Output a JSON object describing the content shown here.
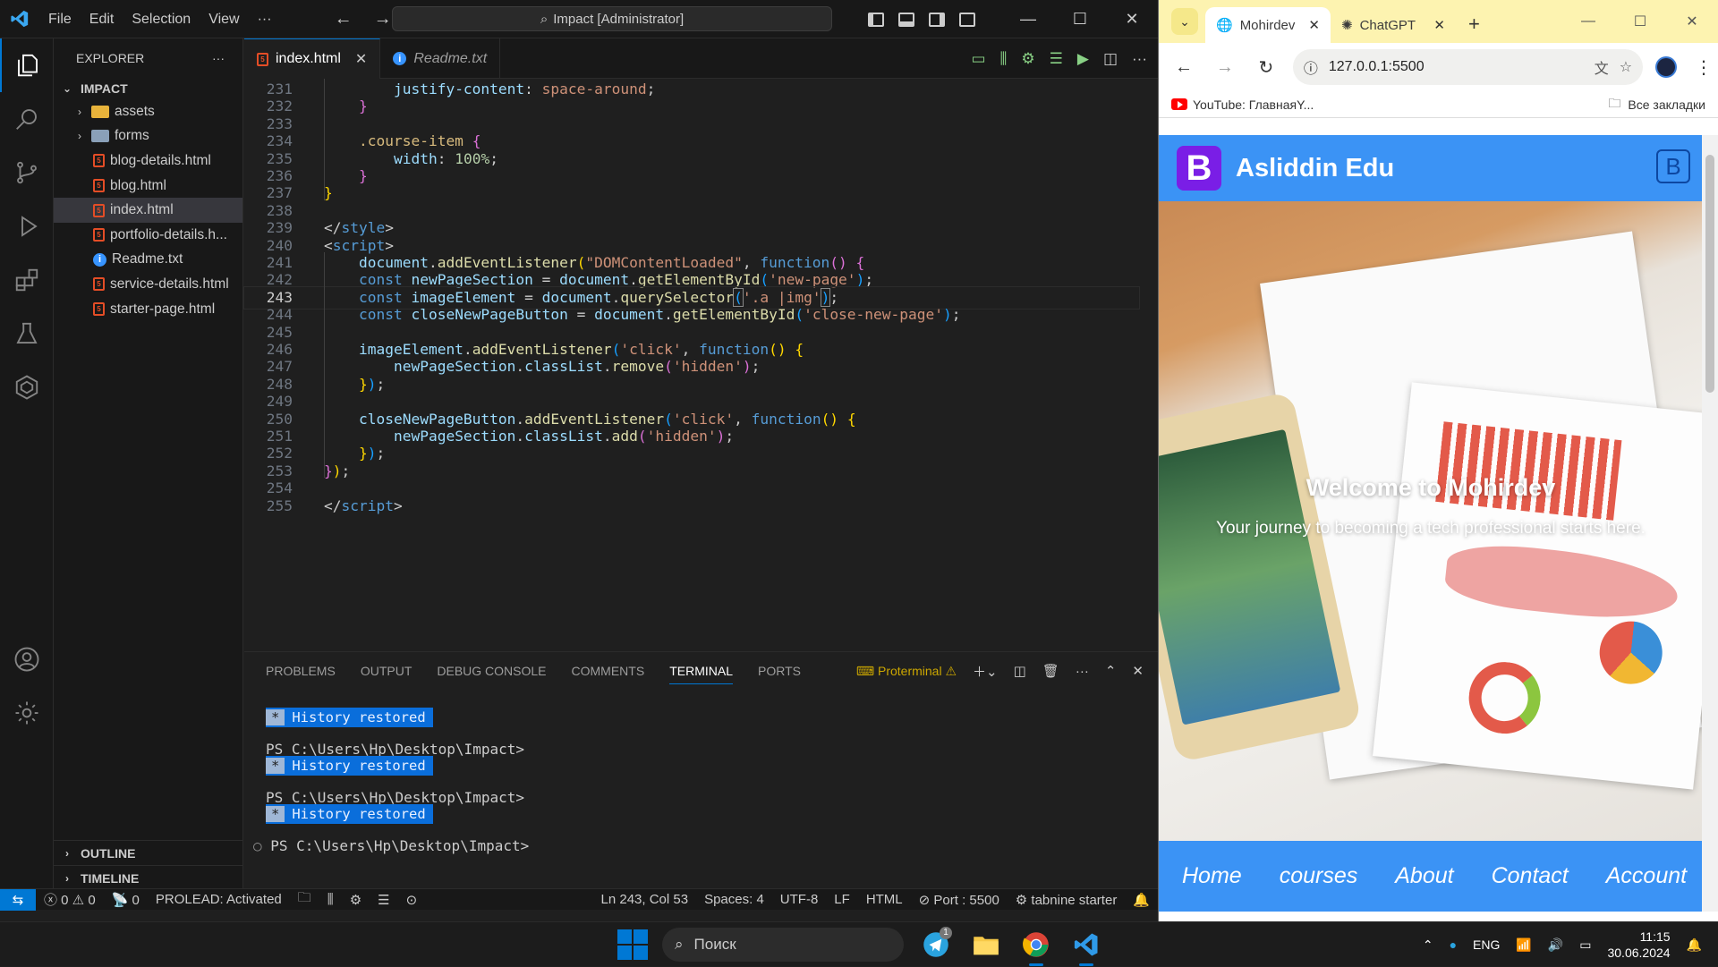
{
  "vscode": {
    "menu": [
      "File",
      "Edit",
      "Selection",
      "View",
      "···"
    ],
    "command_center": "Impact [Administrator]",
    "explorer_title": "EXPLORER",
    "project": "IMPACT",
    "tree": [
      {
        "type": "folder",
        "name": "assets",
        "color": "#e8b33b"
      },
      {
        "type": "folder",
        "name": "forms",
        "color": "#8aa0b8"
      },
      {
        "type": "html",
        "name": "blog-details.html"
      },
      {
        "type": "html",
        "name": "blog.html"
      },
      {
        "type": "html",
        "name": "index.html",
        "selected": true
      },
      {
        "type": "html",
        "name": "portfolio-details.h..."
      },
      {
        "type": "info",
        "name": "Readme.txt"
      },
      {
        "type": "html",
        "name": "service-details.html"
      },
      {
        "type": "html",
        "name": "starter-page.html"
      }
    ],
    "outline_label": "OUTLINE",
    "timeline_label": "TIMELINE",
    "tabs": [
      {
        "name": "index.html",
        "active": true
      },
      {
        "name": "Readme.txt",
        "active": false
      }
    ],
    "code_lines": [
      {
        "n": "231",
        "html": "        <span class=\"p\">justify-content</span><span class=\"pn\">: </span><span class=\"v\">space-around</span><span class=\"pn\">;</span>"
      },
      {
        "n": "232",
        "html": "    <span class=\"br2\">}</span>"
      },
      {
        "n": "233",
        "html": ""
      },
      {
        "n": "234",
        "html": "    <span class=\"cls\">.course-item</span> <span class=\"br2\">{</span>"
      },
      {
        "n": "235",
        "html": "        <span class=\"p\">width</span><span class=\"pn\">: </span><span class=\"n\">100%</span><span class=\"pn\">;</span>"
      },
      {
        "n": "236",
        "html": "    <span class=\"br2\">}</span>"
      },
      {
        "n": "237",
        "html": "<span class=\"br1\">}</span>"
      },
      {
        "n": "238",
        "html": ""
      },
      {
        "n": "239",
        "html": "<span class=\"pn\">&lt;/</span><span class=\"t\">style</span><span class=\"pn\">&gt;</span>"
      },
      {
        "n": "240",
        "html": "<span class=\"pn\">&lt;</span><span class=\"t\">script</span><span class=\"pn\">&gt;</span>"
      },
      {
        "n": "241",
        "html": "    <span class=\"id\">document</span><span class=\"pn\">.</span><span class=\"f\">addEventListener</span><span class=\"br1\">(</span><span class=\"s\">\"DOMContentLoaded\"</span><span class=\"pn\">, </span><span class=\"kw\">function</span><span class=\"br2\">()</span> <span class=\"br2\">{</span>"
      },
      {
        "n": "242",
        "html": "    <span class=\"kw\">const</span> <span class=\"id\">newPageSection</span> <span class=\"pn\">= </span><span class=\"id\">document</span><span class=\"pn\">.</span><span class=\"f\">getElementById</span><span class=\"br3\">(</span><span class=\"s\">'new-page'</span><span class=\"br3\">)</span><span class=\"pn\">;</span>"
      },
      {
        "n": "243",
        "current": true,
        "html": "    <span class=\"kw\">const</span> <span class=\"id\">imageElement</span> <span class=\"pn\">= </span><span class=\"id\">document</span><span class=\"pn\">.</span><span class=\"f\">querySelector</span><span class=\"br3\" style=\"outline:1px solid #888\">(</span><span class=\"s\">'.a |img'</span><span class=\"br3\" style=\"outline:1px solid #888\">)</span><span class=\"pn\">;</span>"
      },
      {
        "n": "244",
        "html": "    <span class=\"kw\">const</span> <span class=\"id\">closeNewPageButton</span> <span class=\"pn\">= </span><span class=\"id\">document</span><span class=\"pn\">.</span><span class=\"f\">getElementById</span><span class=\"br3\">(</span><span class=\"s\">'close-new-page'</span><span class=\"br3\">)</span><span class=\"pn\">;</span>"
      },
      {
        "n": "245",
        "html": ""
      },
      {
        "n": "246",
        "html": "    <span class=\"id\">imageElement</span><span class=\"pn\">.</span><span class=\"f\">addEventListener</span><span class=\"br3\">(</span><span class=\"s\">'click'</span><span class=\"pn\">, </span><span class=\"kw\">function</span><span class=\"br1\">()</span> <span class=\"br1\">{</span>"
      },
      {
        "n": "247",
        "html": "        <span class=\"id\">newPageSection</span><span class=\"pn\">.</span><span class=\"id\">classList</span><span class=\"pn\">.</span><span class=\"f\">remove</span><span class=\"br2\">(</span><span class=\"s\">'hidden'</span><span class=\"br2\">)</span><span class=\"pn\">;</span>"
      },
      {
        "n": "248",
        "html": "    <span class=\"br1\">}</span><span class=\"br3\">)</span><span class=\"pn\">;</span>"
      },
      {
        "n": "249",
        "html": ""
      },
      {
        "n": "250",
        "html": "    <span class=\"id\">closeNewPageButton</span><span class=\"pn\">.</span><span class=\"f\">addEventListener</span><span class=\"br3\">(</span><span class=\"s\">'click'</span><span class=\"pn\">, </span><span class=\"kw\">function</span><span class=\"br1\">()</span> <span class=\"br1\">{</span>"
      },
      {
        "n": "251",
        "html": "        <span class=\"id\">newPageSection</span><span class=\"pn\">.</span><span class=\"id\">classList</span><span class=\"pn\">.</span><span class=\"f\">add</span><span class=\"br2\">(</span><span class=\"s\">'hidden'</span><span class=\"br2\">)</span><span class=\"pn\">;</span>"
      },
      {
        "n": "252",
        "html": "    <span class=\"br1\">}</span><span class=\"br3\">)</span><span class=\"pn\">;</span>"
      },
      {
        "n": "253",
        "html": "<span class=\"br2\">}</span><span class=\"br1\">)</span><span class=\"pn\">;</span>"
      },
      {
        "n": "254",
        "html": ""
      },
      {
        "n": "255",
        "html": "<span class=\"pn\">&lt;/</span><span class=\"t\">script</span><span class=\"pn\">&gt;</span>"
      }
    ],
    "panel_tabs": [
      {
        "name": "PROBLEMS"
      },
      {
        "name": "OUTPUT"
      },
      {
        "name": "DEBUG CONSOLE"
      },
      {
        "name": "COMMENTS"
      },
      {
        "name": "TERMINAL",
        "active": true
      },
      {
        "name": "PORTS"
      }
    ],
    "terminal_profile": "Proterminal",
    "terminal": {
      "history_label": "History restored",
      "history_star": "*",
      "prompt": "PS C:\\Users\\Hp\\Desktop\\Impact>"
    },
    "status": {
      "errors": "0",
      "warnings": "0",
      "ports": "0",
      "prolead": "PROLEAD: Activated",
      "position": "Ln 243, Col 53",
      "spaces": "Spaces: 4",
      "encoding": "UTF-8",
      "eol": "LF",
      "language": "HTML",
      "port": "Port : 5500",
      "tabnine": "tabnine starter"
    }
  },
  "browser": {
    "tabs": [
      {
        "title": "Mohirdev",
        "active": true
      },
      {
        "title": "ChatGPT",
        "active": false
      }
    ],
    "url": "127.0.0.1:5500",
    "bookmark": "YouTube: ГлавнаяY...",
    "all_bookmarks": "Все закладки",
    "site": {
      "brand_letter": "B",
      "brand_name": "Asliddin Edu",
      "hero_title": "Welcome to Mohirdev",
      "hero_subtitle": "Your journey to becoming a tech professional starts here.",
      "nav": [
        "Home",
        "courses",
        "About",
        "Contact",
        "Account"
      ],
      "colors": {
        "primary": "#3b93f5",
        "brand": "#7a1ee6"
      }
    }
  },
  "taskbar": {
    "search": "Поиск",
    "telegram_badge": "1",
    "lang": "ENG",
    "time": "11:15",
    "date": "30.06.2024"
  }
}
